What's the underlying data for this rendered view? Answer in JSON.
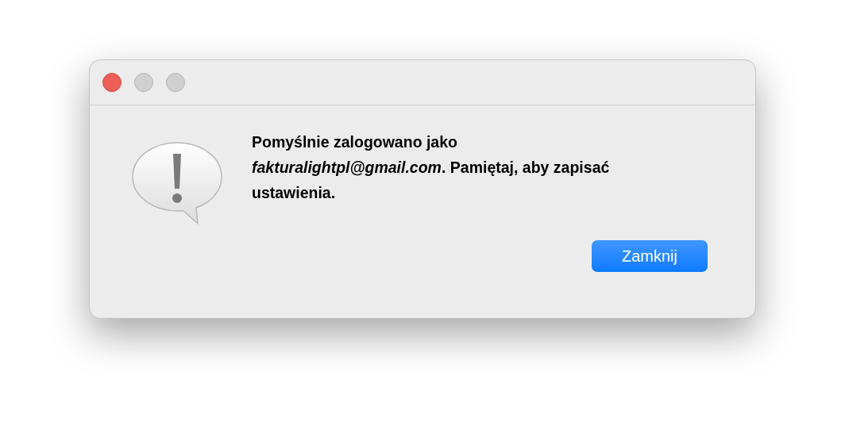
{
  "window": {
    "controls": [
      {
        "kind": "close",
        "disabled": false
      },
      {
        "kind": "minimize",
        "disabled": true
      },
      {
        "kind": "zoom",
        "disabled": true
      }
    ]
  },
  "alert": {
    "message": "Pomyślnie zalogowano jako *fakturalightpl@gmail.com*. Pamiętaj, aby zapisać ustawienia.",
    "buttons": [
      {
        "label": "Zamknij",
        "default": true
      }
    ]
  }
}
